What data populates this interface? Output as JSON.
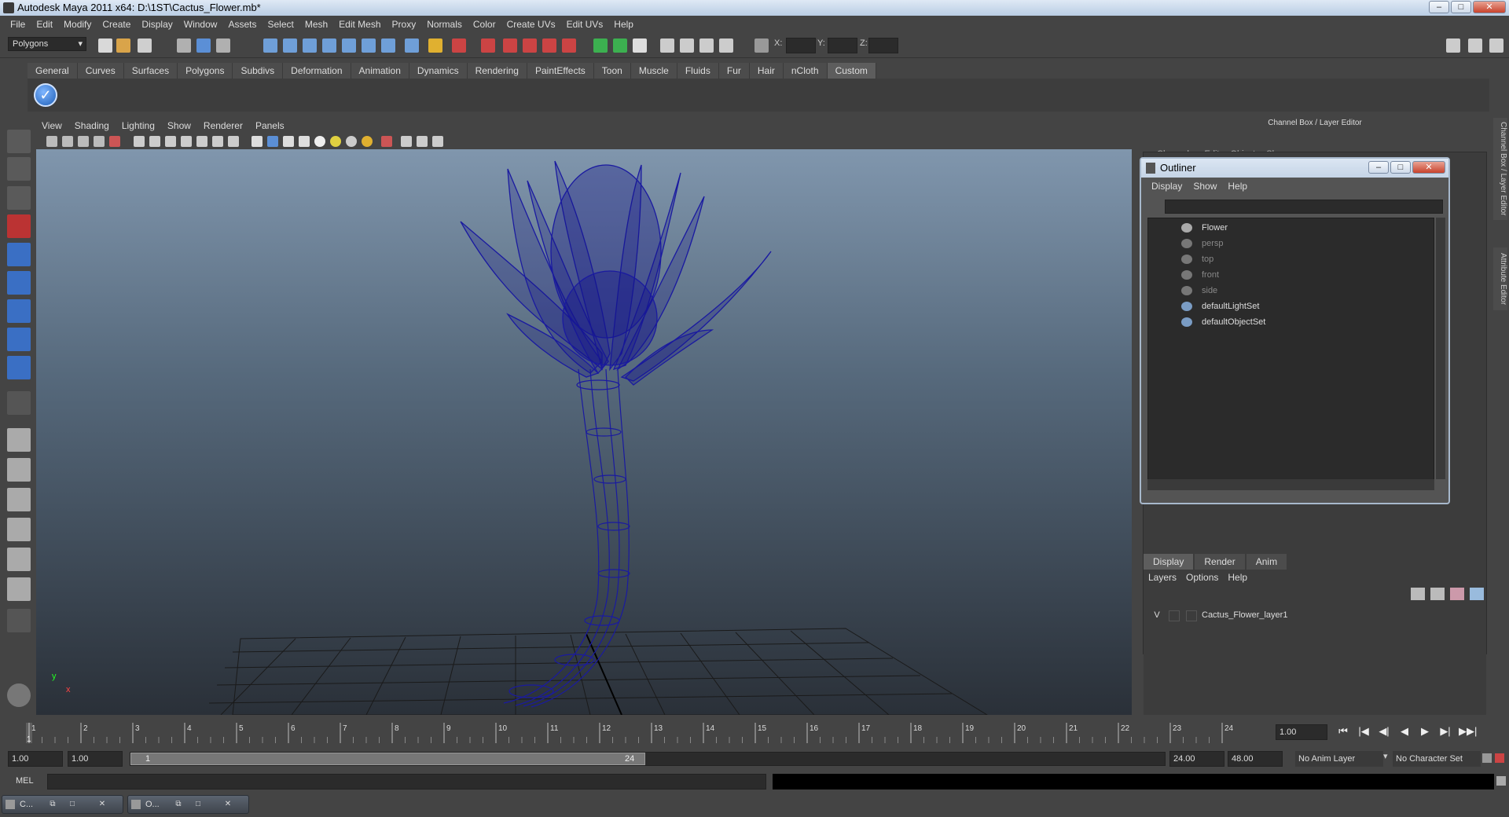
{
  "window": {
    "title": "Autodesk Maya 2011 x64: D:\\1ST\\Cactus_Flower.mb*",
    "min": "–",
    "max": "□",
    "close": "✕"
  },
  "menubar": [
    "File",
    "Edit",
    "Modify",
    "Create",
    "Display",
    "Window",
    "Assets",
    "Select",
    "Mesh",
    "Edit Mesh",
    "Proxy",
    "Normals",
    "Color",
    "Create UVs",
    "Edit UVs",
    "Help"
  ],
  "status": {
    "mode": "Polygons",
    "x_label": "X:",
    "y_label": "Y:",
    "z_label": "Z:"
  },
  "shelf_tabs": [
    "General",
    "Curves",
    "Surfaces",
    "Polygons",
    "Subdivs",
    "Deformation",
    "Animation",
    "Dynamics",
    "Rendering",
    "PaintEffects",
    "Toon",
    "Muscle",
    "Fluids",
    "Fur",
    "Hair",
    "nCloth",
    "Custom"
  ],
  "shelf_active": "Custom",
  "viewport_menu": [
    "View",
    "Shading",
    "Lighting",
    "Show",
    "Renderer",
    "Panels"
  ],
  "axis": {
    "y": "y",
    "x": "x"
  },
  "channel_box": {
    "title": "Channel Box / Layer Editor",
    "menu": [
      "Channels",
      "Edit",
      "Object",
      "Show"
    ]
  },
  "side_tabs": [
    "Channel Box / Layer Editor",
    "Attribute Editor"
  ],
  "outliner": {
    "title": "Outliner",
    "menu": [
      "Display",
      "Show",
      "Help"
    ],
    "items": [
      {
        "label": "Flower",
        "dim": false
      },
      {
        "label": "persp",
        "dim": true
      },
      {
        "label": "top",
        "dim": true
      },
      {
        "label": "front",
        "dim": true
      },
      {
        "label": "side",
        "dim": true
      },
      {
        "label": "defaultLightSet",
        "dim": false
      },
      {
        "label": "defaultObjectSet",
        "dim": false
      }
    ]
  },
  "layer_editor": {
    "tabs": [
      "Display",
      "Render",
      "Anim"
    ],
    "active_tab": "Display",
    "menu": [
      "Layers",
      "Options",
      "Help"
    ],
    "layer": {
      "visible": "V",
      "name": "Cactus_Flower_layer1"
    }
  },
  "time_slider": {
    "ticks": [
      "1",
      "2",
      "3",
      "4",
      "5",
      "6",
      "7",
      "8",
      "9",
      "10",
      "11",
      "12",
      "13",
      "14",
      "15",
      "16",
      "17",
      "18",
      "19",
      "20",
      "21",
      "22",
      "23",
      "24"
    ],
    "current_frame": "1",
    "current_field": "1.00"
  },
  "playback": [
    "⏮",
    "|◀",
    "◀|",
    "◀",
    "▶",
    "▶|",
    "▶▶|"
  ],
  "range": {
    "start": "1.00",
    "anim_start": "1.00",
    "range_start": "1",
    "range_end": "24",
    "anim_end": "24.00",
    "end": "48.00",
    "anim_layer": "No Anim Layer",
    "char_set": "No Character Set"
  },
  "cmdline": {
    "label": "MEL"
  },
  "minimized": [
    {
      "title": "C..."
    },
    {
      "title": "O..."
    }
  ]
}
